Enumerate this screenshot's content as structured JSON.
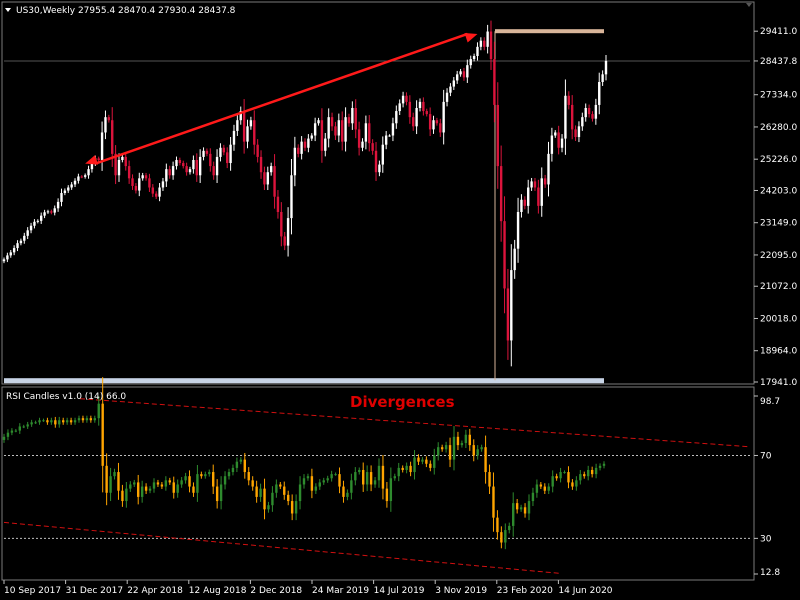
{
  "chart_data": [
    {
      "type": "candlestick",
      "symbol_header": "US30,Weekly  27955.4 28470.4 27930.4 28437.8",
      "ylim": [
        17941.0,
        30300
      ],
      "yticks": [
        "29411.0",
        "28437.8",
        "27334.0",
        "26280.0",
        "25226.0",
        "24203.0",
        "23149.0",
        "22095.0",
        "21072.0",
        "20018.0",
        "18964.0",
        "17941.0"
      ],
      "current_price": "28437.8",
      "series": [
        {
          "values_close": [
            21950,
            22080,
            22180,
            22320,
            22480,
            22560,
            22720,
            22900,
            23050,
            23180,
            23210,
            23380,
            23490,
            23520,
            23480,
            23620,
            23830,
            24120,
            24200,
            24300,
            24400,
            24520,
            24660,
            24650,
            24700,
            24900,
            25100,
            25250,
            25200,
            26100,
            26600,
            26500,
            25400,
            24700,
            25200,
            25300,
            25000,
            24600,
            24350,
            24200,
            24600,
            24700,
            24600,
            24300,
            24100,
            24000,
            24300,
            24500,
            24900,
            24700,
            25000,
            25200,
            25100,
            25000,
            24800,
            24900,
            25200,
            24700,
            25300,
            25500,
            25400,
            25000,
            24700,
            25300,
            25600,
            25450,
            25100,
            25700,
            26150,
            26500,
            26800,
            25800,
            26300,
            26500,
            25700,
            25300,
            24800,
            24400,
            24800,
            25000,
            24000,
            23500,
            22700,
            22400,
            23300,
            24700,
            25600,
            25400,
            25800,
            25600,
            25900,
            26000,
            26400,
            26500,
            25500,
            25900,
            26600,
            26300,
            26000,
            26500,
            25800,
            26600,
            26400,
            26900,
            26200,
            25600,
            25800,
            26400,
            25750,
            25500,
            24800,
            25050,
            25700,
            26000,
            26000,
            26400,
            26800,
            27050,
            27300,
            27100,
            26600,
            26300,
            26900,
            27100,
            26800,
            26700,
            26200,
            26500,
            26400,
            26100,
            27100,
            27400,
            27600,
            27800,
            28000,
            28100,
            27900,
            28300,
            28500,
            28600,
            28900,
            29100,
            28900,
            29400,
            28500,
            27000,
            25000,
            23200,
            21000,
            19300,
            21600,
            22300,
            23500,
            23900,
            23700,
            24300,
            24500,
            24300,
            23700,
            24600,
            24400,
            25400,
            26000,
            26100,
            25600,
            25900,
            27300,
            27000,
            26200,
            25950,
            26300,
            26600,
            26900,
            26700,
            26550,
            27000,
            27750,
            28000,
            28437.8
          ]
        }
      ],
      "annotations": {
        "trend_arrow": {
          "from_index": 24,
          "to_index": 140
        },
        "high_line": "29411.0",
        "low_line": "18000.0"
      }
    },
    {
      "type": "rsi-candles",
      "header": "RSI Candles v1.0 (14) 66.0",
      "title": "Divergences",
      "ylim": [
        12.8,
        98.7
      ],
      "yticks": [
        "98.7",
        "70",
        "30",
        "12.8"
      ],
      "levels": [
        70,
        30
      ],
      "series": [
        {
          "values_close": [
            79,
            81,
            82,
            82,
            84,
            84,
            85,
            86,
            86,
            87,
            87,
            86,
            87,
            85,
            87,
            86,
            87,
            86,
            87,
            88,
            87,
            88,
            87,
            88,
            95,
            65,
            52,
            60,
            62,
            53,
            48,
            54,
            56,
            57,
            50,
            55,
            53,
            54,
            57,
            56,
            55,
            58,
            57,
            52,
            56,
            58,
            60,
            55,
            52,
            61,
            60,
            61,
            62,
            55,
            48,
            56,
            60,
            62,
            64,
            67,
            68,
            62,
            58,
            55,
            50,
            54,
            44,
            46,
            52,
            56,
            55,
            51,
            48,
            42,
            48,
            56,
            59,
            60,
            53,
            55,
            57,
            58,
            59,
            61,
            61,
            55,
            50,
            52,
            58,
            62,
            63,
            56,
            62,
            56,
            58,
            65,
            54,
            48,
            59,
            60,
            64,
            63,
            65,
            62,
            69,
            67,
            68,
            66,
            64,
            70,
            74,
            73,
            75,
            68,
            79,
            75,
            76,
            80,
            75,
            70,
            73,
            74,
            62,
            55,
            40,
            33,
            28,
            34,
            36,
            47,
            44,
            45,
            42,
            48,
            52,
            56,
            55,
            53,
            55,
            60,
            59,
            62,
            62,
            57,
            55,
            58,
            61,
            60,
            63,
            61,
            64,
            65,
            66
          ]
        }
      ],
      "divergence_lines": "dashed red trendlines"
    }
  ],
  "x_axis_labels": [
    "10 Sep 2017",
    "31 Dec 2017",
    "22 Apr 2018",
    "12 Aug 2018",
    "2 Dec 2018",
    "24 Mar 2019",
    "14 Jul 2019",
    "3 Nov 2019",
    "23 Feb 2020",
    "14 Jun 2020"
  ],
  "colors": {
    "bull_price": "#ffffff",
    "bear_price": "#dc143c",
    "bull_rsi": "#2e8b2e",
    "bear_rsi": "#ffa500",
    "arrow": "#ff1a1a",
    "high_line": "#d9b59a",
    "low_line": "#c8d4e6",
    "grid": "#404040"
  }
}
